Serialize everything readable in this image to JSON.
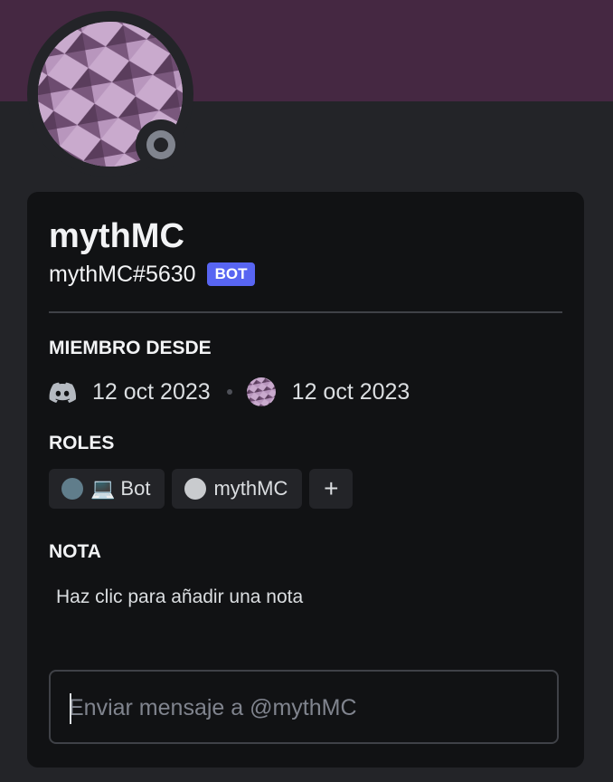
{
  "profile": {
    "display_name": "mythMC",
    "username": "mythMC#5630",
    "bot_badge": "BOT",
    "status": "offline"
  },
  "member_since": {
    "title": "MIEMBRO DESDE",
    "discord_icon": "discord-icon",
    "discord_date": "12 oct 2023",
    "server_date": "12 oct 2023"
  },
  "roles": {
    "title": "ROLES",
    "items": [
      {
        "label": "Bot",
        "emoji": "💻",
        "color": "#607d8b"
      },
      {
        "label": "mythMC",
        "color": "#c9cbce"
      }
    ],
    "add_label": "+"
  },
  "note": {
    "title": "NOTA",
    "placeholder": "Haz clic para añadir una nota"
  },
  "message": {
    "placeholder": "Enviar mensaje a @mythMC"
  },
  "colors": {
    "banner": "#452842",
    "accent": "#5865f2",
    "card": "#111214",
    "background": "#232428"
  }
}
